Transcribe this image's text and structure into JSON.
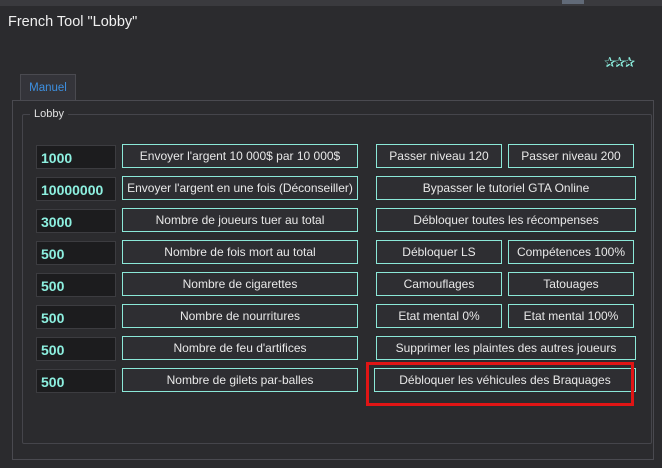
{
  "window": {
    "title": "French Tool \"Lobby\""
  },
  "stars": "✰✰✰",
  "tab": {
    "label": "Manuel"
  },
  "group": {
    "title": "Lobby"
  },
  "left_rows": [
    {
      "value": "1000",
      "button": "Envoyer l'argent 10 000$ par 10 000$"
    },
    {
      "value": "10000000",
      "button": "Envoyer l'argent en une fois (Déconseiller)"
    },
    {
      "value": "3000",
      "button": "Nombre de joueurs tuer au total"
    },
    {
      "value": "500",
      "button": "Nombre de fois mort au total"
    },
    {
      "value": "500",
      "button": "Nombre de cigarettes"
    },
    {
      "value": "500",
      "button": "Nombre de nourritures"
    },
    {
      "value": "500",
      "button": "Nombre de feu d'artifices"
    },
    {
      "value": "500",
      "button": "Nombre de gilets par-balles"
    }
  ],
  "right_buttons": {
    "passer_120": "Passer niveau 120",
    "passer_200": "Passer niveau 200",
    "bypass_tutoriel": "Bypasser le tutoriel GTA Online",
    "debloquer_recompenses": "Débloquer toutes les récompenses",
    "debloquer_ls": "Débloquer LS",
    "competences": "Compétences 100%",
    "camouflages": "Camouflages",
    "tatouages": "Tatouages",
    "etat_0": "Etat mental 0%",
    "etat_100": "Etat mental 100%",
    "supprimer_plaintes": "Supprimer les plaintes des autres joueurs",
    "debloquer_vehicules": "Débloquer les véhicules des Braquages"
  },
  "colors": {
    "accent": "#8df0e0",
    "tab_text": "#3d8fe0",
    "highlight": "#e01515",
    "background": "#2b2b2e"
  }
}
